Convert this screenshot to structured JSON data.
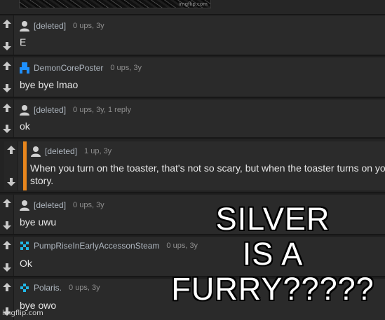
{
  "top": {
    "watermark": "imgflip.com"
  },
  "comments": [
    {
      "username": "[deleted]",
      "stats": "0 ups, 3y",
      "text": "E",
      "avatar": "person-silhouette-icon"
    },
    {
      "username": "DemonCorePoster",
      "stats": "0 ups, 3y",
      "text": "bye bye lmao",
      "avatar": "blue-pixel-figure-icon"
    },
    {
      "username": "[deleted]",
      "stats": "0 ups, 3y, 1 reply",
      "text": "ok",
      "avatar": "person-silhouette-icon"
    },
    {
      "username": "[deleted]",
      "stats": "1 up, 3y",
      "text": "When you turn on the toaster, that's not so scary, but when the toaster turns on you... that's a horror",
      "text2": "story.",
      "avatar": "person-silhouette-icon",
      "is_reply": true
    },
    {
      "username": "[deleted]",
      "stats": "0 ups, 3y",
      "text": "bye uwu",
      "avatar": "person-silhouette-icon"
    },
    {
      "username": "PumpRiseInEarlyAccessonSteam",
      "stats": "0 ups, 3y",
      "text": "Ok",
      "avatar": "blue-pixel-x-icon"
    },
    {
      "username": "Polaris.",
      "stats": "0 ups, 3y",
      "text": "bye owo",
      "avatar": "blue-pixel-diamond-icon"
    }
  ],
  "overlay": {
    "line1": "SILVER",
    "line2": "IS A",
    "line3": "FURRY?????"
  },
  "watermark": "imgflip.com",
  "colors": {
    "accent": "#e8861d",
    "username": "#aeb6bf",
    "stats": "#8e8e8e",
    "pixel_blue": "#1e90ff",
    "pixel_cyan": "#21b8e8"
  }
}
